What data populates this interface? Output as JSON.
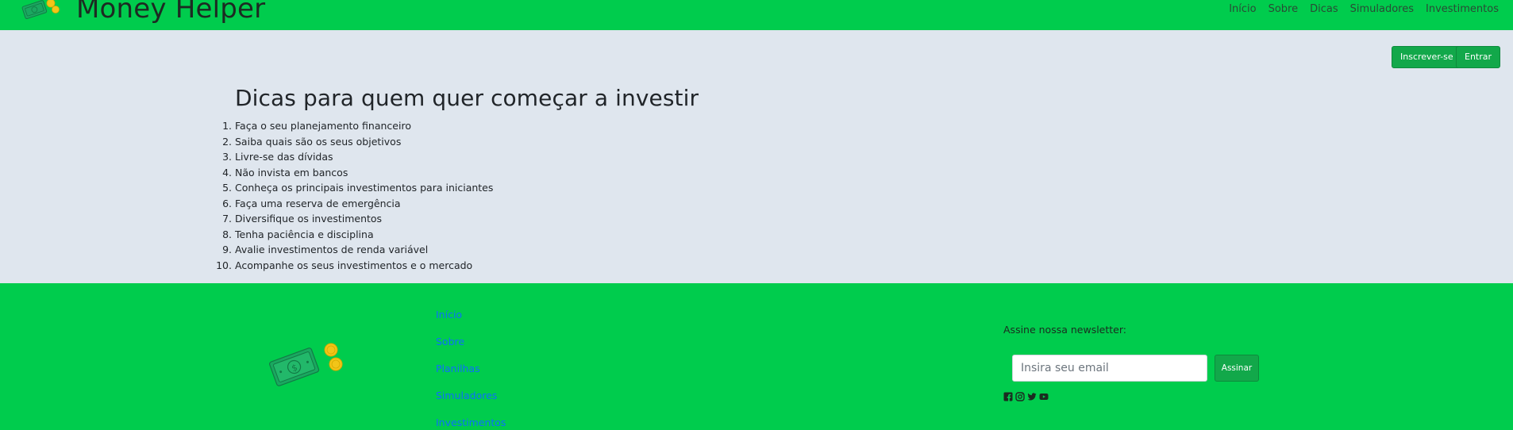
{
  "header": {
    "brand_title": "Money Helper",
    "logo_icon": "money-bills-coins-icon",
    "nav": [
      {
        "label": "Início"
      },
      {
        "label": "Sobre"
      },
      {
        "label": "Dicas"
      },
      {
        "label": "Simuladores"
      },
      {
        "label": "Investimentos"
      }
    ]
  },
  "auth": {
    "signup_label": "Inscrever-se",
    "login_label": "Entrar"
  },
  "main": {
    "title": "Dicas para quem quer começar a investir",
    "tips": [
      "Faça o seu planejamento financeiro",
      "Saiba quais são os seus objetivos",
      "Livre-se das dívidas",
      "Não invista em bancos",
      "Conheça os principais investimentos para iniciantes",
      "Faça uma reserva de emergência",
      "Diversifique os investimentos",
      "Tenha paciência e disciplina",
      "Avalie investimentos de renda variável",
      "Acompanhe os seus investimentos e o mercado"
    ]
  },
  "footer": {
    "links": [
      {
        "label": "Início"
      },
      {
        "label": "Sobre"
      },
      {
        "label": "Planilhas"
      },
      {
        "label": "Simuladores"
      },
      {
        "label": "Investimentos"
      }
    ],
    "newsletter_label": "Assine nossa newsletter:",
    "email_placeholder": "Insira seu email",
    "subscribe_label": "Assinar",
    "socials": [
      "facebook-icon",
      "instagram-icon",
      "twitter-icon",
      "youtube-icon"
    ]
  },
  "colors": {
    "brand_green": "#00cc4d",
    "button_green": "#12a84a",
    "page_bg": "#dfe6ee",
    "link_blue": "#0d6efd"
  }
}
